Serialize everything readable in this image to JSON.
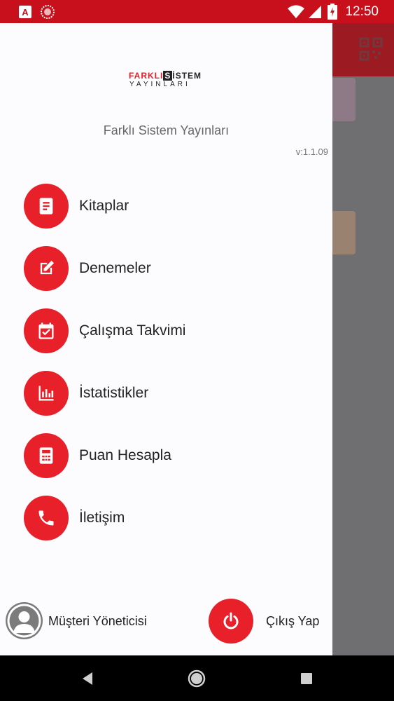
{
  "status_bar": {
    "time": "12:50",
    "icons": [
      "app-notification-icon",
      "badge-notification-icon",
      "wifi-icon",
      "signal-icon",
      "battery-icon"
    ]
  },
  "drawer": {
    "logo": {
      "line1_a": "FARKLI",
      "line1_b": "S",
      "line1_c": "İSTEM",
      "line2": "YAYINLARI"
    },
    "company_name": "Farklı Sistem Yayınları",
    "version": "v:1.1.09",
    "menu": [
      {
        "label": "Kitaplar",
        "icon": "book-icon"
      },
      {
        "label": "Denemeler",
        "icon": "edit-icon"
      },
      {
        "label": "Çalışma Takvimi",
        "icon": "calendar-check-icon"
      },
      {
        "label": "İstatistikler",
        "icon": "bar-chart-icon"
      },
      {
        "label": "Puan Hesapla",
        "icon": "calculator-icon"
      },
      {
        "label": "İletişim",
        "icon": "phone-icon"
      }
    ],
    "user_label": "Müşteri Yöneticisi",
    "logout_label": "Çıkış Yap"
  },
  "colors": {
    "accent": "#e8202a",
    "status_bar": "#c7101c",
    "scrim": "#6f6f71"
  },
  "navbar": {
    "icons": [
      "back-icon",
      "home-icon",
      "recents-icon"
    ]
  }
}
